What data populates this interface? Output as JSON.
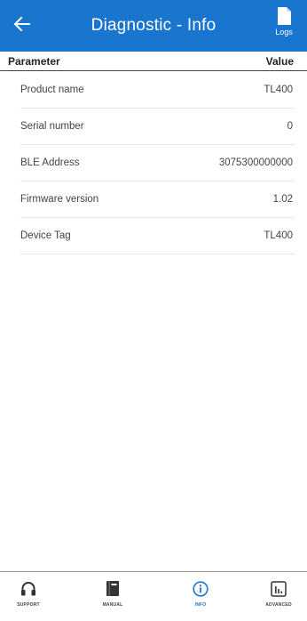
{
  "header": {
    "title": "Diagnostic - Info",
    "logs_label": "Logs",
    "back_icon": "arrow-left-icon",
    "logs_icon": "file-icon",
    "color": "#1a75cf"
  },
  "table": {
    "param_header": "Parameter",
    "value_header": "Value",
    "rows": [
      {
        "parameter": "Product name",
        "value": "TL400"
      },
      {
        "parameter": "Serial number",
        "value": "0"
      },
      {
        "parameter": "BLE Address",
        "value": "3075300000000"
      },
      {
        "parameter": "Firmware version",
        "value": "1.02"
      },
      {
        "parameter": "Device Tag",
        "value": "TL400"
      }
    ]
  },
  "nav": {
    "active": "info",
    "active_color": "#1a75cf",
    "items": [
      {
        "id": "support",
        "label": "SUPPORT",
        "icon": "headset-icon"
      },
      {
        "id": "manual",
        "label": "MANUAL",
        "icon": "book-icon"
      },
      {
        "id": "info",
        "label": "INFO",
        "icon": "info-circle-icon"
      },
      {
        "id": "advanced",
        "label": "ADVANCED",
        "icon": "bar-chart-icon"
      }
    ]
  }
}
